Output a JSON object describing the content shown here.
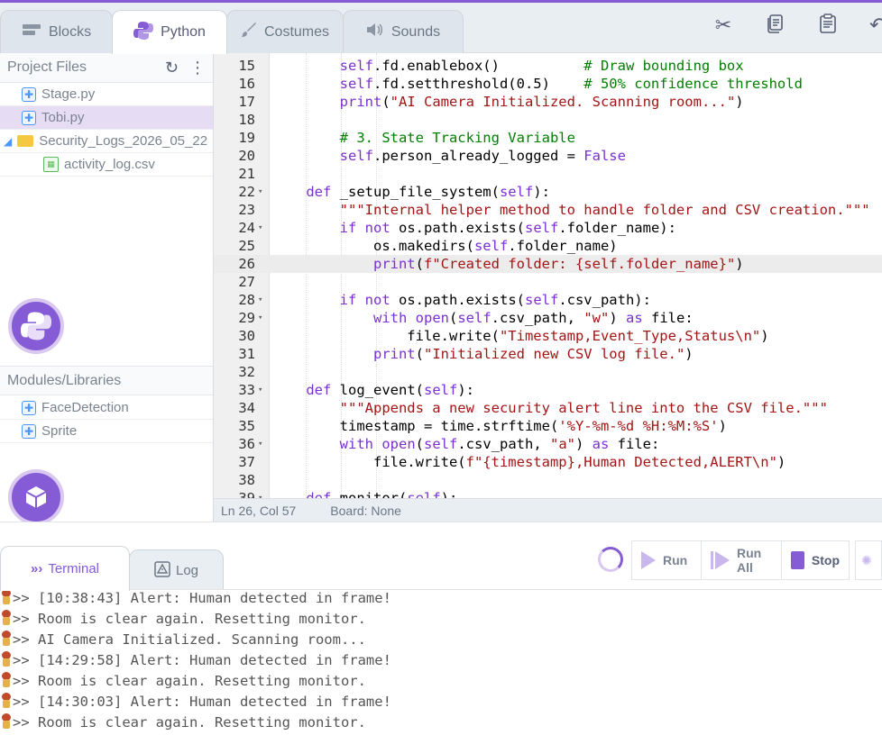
{
  "top_tabs": [
    {
      "label": "Blocks",
      "icon": "blocks-icon"
    },
    {
      "label": "Python",
      "icon": "python-icon"
    },
    {
      "label": "Costumes",
      "icon": "brush-icon"
    },
    {
      "label": "Sounds",
      "icon": "speaker-icon"
    }
  ],
  "toolbar_icons": [
    "scissors-icon",
    "copy-icon",
    "clipboard-icon",
    "undo-icon"
  ],
  "sidebar": {
    "project_files_label": "Project Files",
    "files": [
      {
        "name": "Stage.py",
        "type": "python",
        "selected": false
      },
      {
        "name": "Tobi.py",
        "type": "python",
        "selected": true
      },
      {
        "name": "Security_Logs_2026_05_22",
        "type": "folder",
        "selected": false
      },
      {
        "name": "activity_log.csv",
        "type": "csv",
        "selected": false
      }
    ],
    "modules_label": "Modules/Libraries",
    "modules": [
      {
        "name": "FaceDetection"
      },
      {
        "name": "Sprite"
      }
    ]
  },
  "editor": {
    "lines": [
      {
        "n": "15",
        "fold": "",
        "code": "        self.fd.enablebox()          # Draw bounding box"
      },
      {
        "n": "16",
        "fold": "",
        "code": "        self.fd.setthreshold(0.5)    # 50% confidence threshold"
      },
      {
        "n": "17",
        "fold": "",
        "code": "        print(\"AI Camera Initialized. Scanning room...\")"
      },
      {
        "n": "18",
        "fold": "",
        "code": ""
      },
      {
        "n": "19",
        "fold": "",
        "code": "        # 3. State Tracking Variable"
      },
      {
        "n": "20",
        "fold": "",
        "code": "        self.person_already_logged = False"
      },
      {
        "n": "21",
        "fold": "",
        "code": ""
      },
      {
        "n": "22",
        "fold": "▾",
        "code": "    def _setup_file_system(self):"
      },
      {
        "n": "23",
        "fold": "",
        "code": "        \"\"\"Internal helper method to handle folder and CSV creation.\"\"\""
      },
      {
        "n": "24",
        "fold": "▾",
        "code": "        if not os.path.exists(self.folder_name):"
      },
      {
        "n": "25",
        "fold": "",
        "code": "            os.makedirs(self.folder_name)"
      },
      {
        "n": "26",
        "fold": "",
        "code": "            print(f\"Created folder: {self.folder_name}\")"
      },
      {
        "n": "27",
        "fold": "",
        "code": ""
      },
      {
        "n": "28",
        "fold": "▾",
        "code": "        if not os.path.exists(self.csv_path):"
      },
      {
        "n": "29",
        "fold": "▾",
        "code": "            with open(self.csv_path, \"w\") as file:"
      },
      {
        "n": "30",
        "fold": "",
        "code": "                file.write(\"Timestamp,Event_Type,Status\\n\")"
      },
      {
        "n": "31",
        "fold": "",
        "code": "            print(\"Initialized new CSV log file.\")"
      },
      {
        "n": "32",
        "fold": "",
        "code": ""
      },
      {
        "n": "33",
        "fold": "▾",
        "code": "    def log_event(self):"
      },
      {
        "n": "34",
        "fold": "",
        "code": "        \"\"\"Appends a new security alert line into the CSV file.\"\"\""
      },
      {
        "n": "35",
        "fold": "",
        "code": "        timestamp = time.strftime('%Y-%m-%d %H:%M:%S')"
      },
      {
        "n": "36",
        "fold": "▾",
        "code": "        with open(self.csv_path, \"a\") as file:"
      },
      {
        "n": "37",
        "fold": "",
        "code": "            file.write(f\"{timestamp},Human Detected,ALERT\\n\")"
      },
      {
        "n": "38",
        "fold": "",
        "code": ""
      },
      {
        "n": "39",
        "fold": "▾",
        "code": "    def monitor(self):"
      }
    ],
    "active_line": "26"
  },
  "status_bar": {
    "cursor": "Ln 26, Col 57",
    "board": "Board: None"
  },
  "bottom_tabs": [
    {
      "label": "Terminal",
      "icon": "chevrons-icon"
    },
    {
      "label": "Log",
      "icon": "warning-icon"
    }
  ],
  "controls": {
    "run_label": "Run",
    "run_all_label": "Run All",
    "stop_label": "Stop"
  },
  "terminal": {
    "lines": [
      ">> [10:38:43] Alert: Human detected in frame!",
      ">> Room is clear again. Resetting monitor.",
      ">> AI Camera Initialized. Scanning room...",
      ">> [14:29:58] Alert: Human detected in frame!",
      ">> Room is clear again. Resetting monitor.",
      ">> [14:30:03] Alert: Human detected in frame!",
      ">> Room is clear again. Resetting monitor."
    ]
  },
  "colors": {
    "accent": "#855cd6",
    "selected_file_bg": "#e6dcf3"
  }
}
